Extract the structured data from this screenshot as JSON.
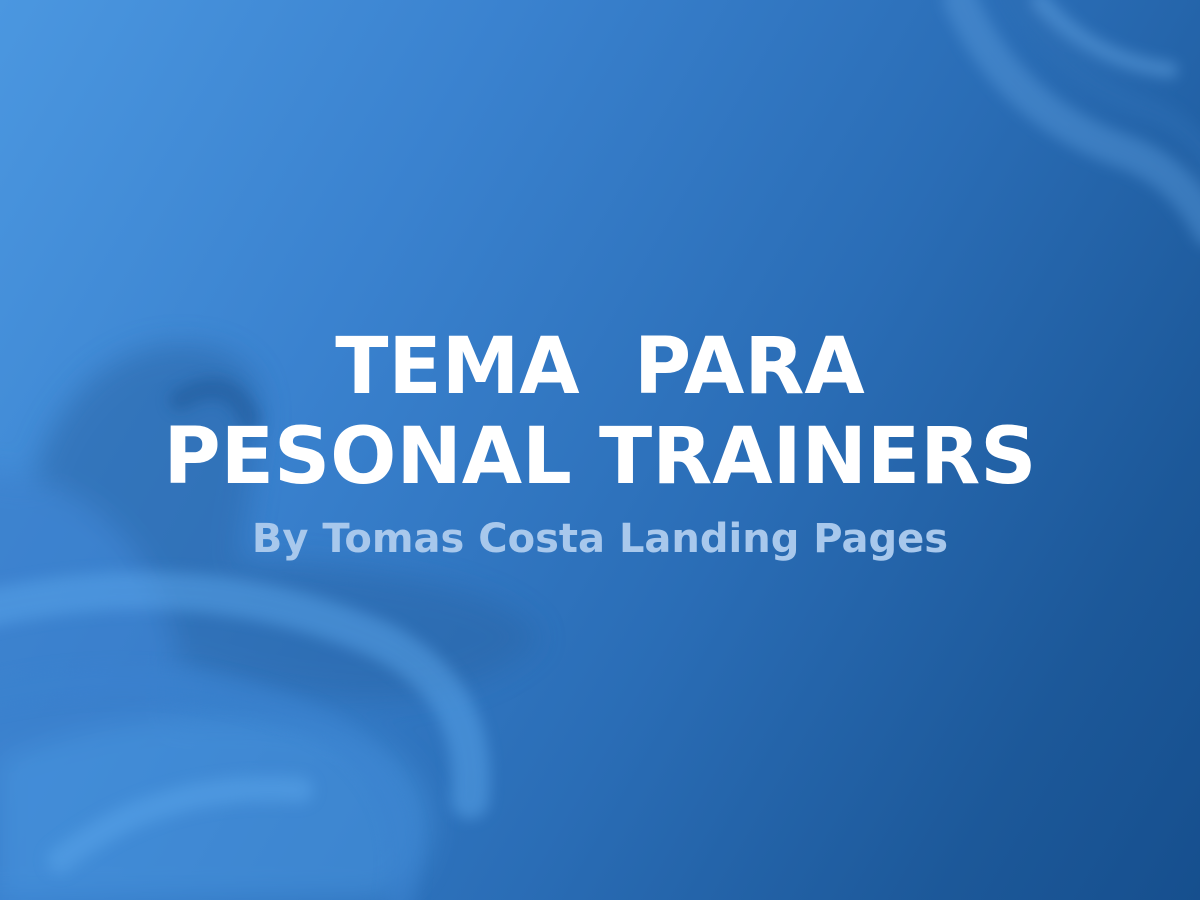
{
  "hero": {
    "title_line_1": "TEMA  PARA",
    "title_line_2": "PESONAL TRAINERS",
    "subtitle": "By Tomas Costa Landing Pages"
  },
  "colors": {
    "background_light": "#4b97e0",
    "background_dark": "#164f8e",
    "title": "#ffffff",
    "subtitle": "#a8c8ec"
  },
  "background_image": {
    "subject": "blurred-kettlebell-and-rope-icon"
  }
}
